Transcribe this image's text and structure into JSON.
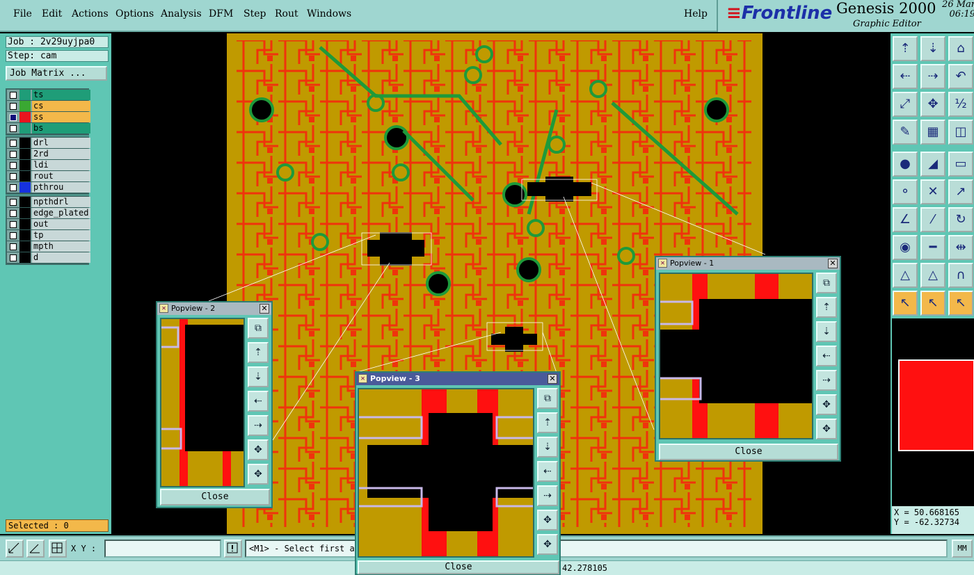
{
  "menu": [
    "File",
    "Edit",
    "Actions",
    "Options",
    "Analysis",
    "DFM",
    "Step",
    "Rout",
    "Windows"
  ],
  "help": "Help",
  "brand": {
    "logo": "Frontline",
    "product": "Genesis 2000",
    "subtitle": "Graphic Editor",
    "date": "26 Mar",
    "time": "06:19"
  },
  "job": {
    "job_label": "Job : 2v29uyjpa0",
    "step_label": "Step: cam",
    "matrix_button": "Job Matrix ..."
  },
  "layers": {
    "group1": [
      {
        "name": "ts",
        "color": "#1f9d78",
        "checked": false
      },
      {
        "name": "cs",
        "color": "#3aa832",
        "checked": false
      },
      {
        "name": "ss",
        "color": "#e8141e",
        "checked": true
      },
      {
        "name": "bs",
        "color": "#1f9d78",
        "checked": false
      }
    ],
    "group2": [
      {
        "name": "drl",
        "color": "#000000",
        "checked": false
      },
      {
        "name": "2rd",
        "color": "#000000",
        "checked": false
      },
      {
        "name": "ldi",
        "color": "#000000",
        "checked": false
      },
      {
        "name": "rout",
        "color": "#000000",
        "checked": false
      },
      {
        "name": "pthrou",
        "color": "#1632e0",
        "checked": false
      }
    ],
    "group3": [
      {
        "name": "npthdrl",
        "color": "#000000",
        "checked": false
      },
      {
        "name": "edge_plated",
        "color": "#000000",
        "checked": false
      },
      {
        "name": "out",
        "color": "#000000",
        "checked": false
      },
      {
        "name": "tp",
        "color": "#000000",
        "checked": false
      },
      {
        "name": "mpth",
        "color": "#000000",
        "checked": false
      },
      {
        "name": "d",
        "color": "#000000",
        "checked": false
      }
    ]
  },
  "selected_text": "Selected : 0",
  "colors": {
    "board": "#c09a00",
    "copper": "#ff1010",
    "pad": "#000000",
    "via_ring": "#1e9a3a",
    "panel": "#5fc6b4"
  },
  "coords": {
    "x": "X = 50.668165",
    "y": "Y = -62.32734"
  },
  "units_button": "MM",
  "xy_label": "X Y :",
  "xy_value": "",
  "prompt": "<M1> - Select first and second point to measure",
  "status_value": "42.278105",
  "popups": [
    {
      "title": "Popview - 2",
      "close": "Close"
    },
    {
      "title": "Popview - 3",
      "close": "Close"
    },
    {
      "title": "Popview - 1",
      "close": "Close"
    }
  ]
}
